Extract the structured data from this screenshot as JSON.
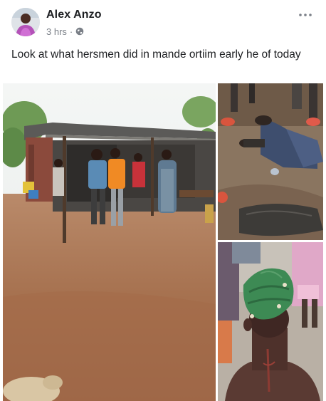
{
  "post": {
    "author": "Alex Anzo",
    "time": "3 hrs",
    "privacy_icon": "globe-icon",
    "more_icon": "more-options-icon",
    "text": "Look at what hersmen did in mande ortiim early he of today"
  },
  "photos": [
    {
      "name": "village-scene"
    },
    {
      "name": "victim-on-ground"
    },
    {
      "name": "injured-man-head-wrap"
    }
  ]
}
